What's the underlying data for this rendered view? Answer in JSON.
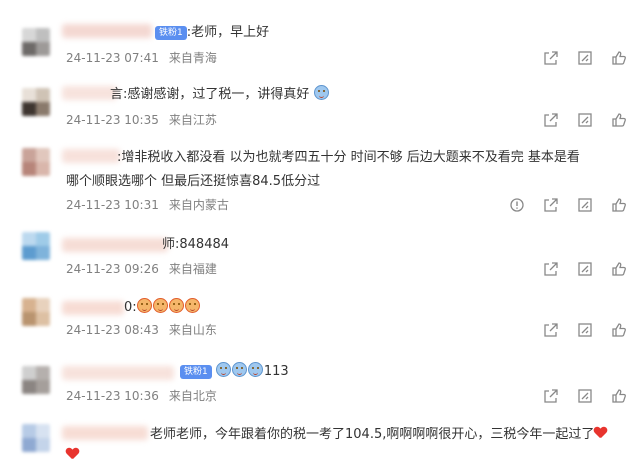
{
  "comments": [
    {
      "badge": "铁粉1",
      "text": ":老师，早上好",
      "date": "24-11-23 07:41",
      "location": "来自青海"
    },
    {
      "text": "言:感谢感谢，过了税一，讲得真好",
      "date": "24-11-23 10:35",
      "location": "来自江苏"
    },
    {
      "text_line1": ":增非税收入都没看   以为也就考四五十分     时间不够     后边大题来不及看完    基本是看",
      "text_line2": "哪个顺眼选哪个     但最后还挺惊喜84.5低分过",
      "date": "24-11-23 10:31",
      "location": "来自内蒙古"
    },
    {
      "text": "师:848484",
      "date": "24-11-23 09:26",
      "location": "来自福建"
    },
    {
      "text": "0:",
      "date": "24-11-23 08:43",
      "location": "来自山东"
    },
    {
      "badge": "铁粉1",
      "text": "113",
      "date": "24-11-23 10:36",
      "location": "来自北京"
    },
    {
      "text": "老师老师，今年跟着你的税一考了104.5,啊啊啊啊很开心，三税今年一起过了"
    }
  ],
  "icons": {
    "share": "share-icon",
    "reply": "reply-icon",
    "like": "like-icon",
    "report": "report-icon",
    "emoji": "smile-emoji-icon",
    "heart": "heart-icon"
  },
  "colors": {
    "meta": "#808080",
    "badge": "#5b8ff0",
    "heart": "#e8342e"
  }
}
